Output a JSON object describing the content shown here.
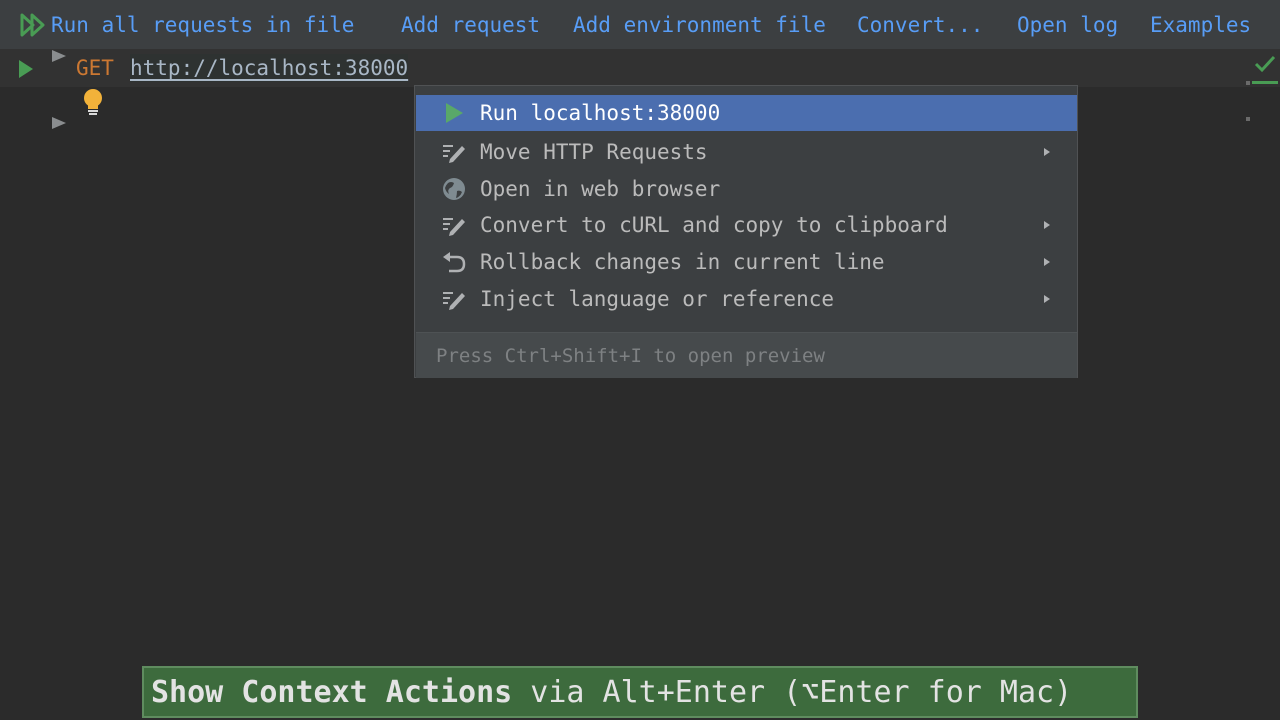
{
  "toolbar": {
    "run_all": "Run all requests in file",
    "add_request": "Add request",
    "add_env": "Add environment file",
    "convert": "Convert...",
    "open_log": "Open log",
    "examples": "Examples"
  },
  "editor": {
    "method": "GET",
    "url": "http://localhost:38000"
  },
  "context_menu": {
    "items": [
      {
        "label": "Run localhost:38000",
        "icon": "run-icon",
        "has_submenu": false,
        "selected": true
      },
      {
        "label": "Move HTTP Requests",
        "icon": "intention-edit-icon",
        "has_submenu": true,
        "selected": false
      },
      {
        "label": "Open in web browser",
        "icon": "globe-icon",
        "has_submenu": false,
        "selected": false
      },
      {
        "label": "Convert to cURL and copy to clipboard",
        "icon": "intention-edit-icon",
        "has_submenu": true,
        "selected": false
      },
      {
        "label": "Rollback changes in current line",
        "icon": "rollback-icon",
        "has_submenu": true,
        "selected": false
      },
      {
        "label": "Inject language or reference",
        "icon": "intention-edit-icon",
        "has_submenu": true,
        "selected": false
      }
    ],
    "footer": "Press Ctrl+Shift+I to open preview"
  },
  "tip": {
    "strong": "Show Context Actions",
    "rest": "via Alt+Enter (⌥Enter for Mac)"
  },
  "colors": {
    "accent_blue": "#589df6",
    "selection": "#4b6eaf",
    "run_green": "#499c54",
    "method_orange": "#cc7832",
    "bulb_yellow": "#f2b23a",
    "tip_green": "#3d6b3d"
  }
}
